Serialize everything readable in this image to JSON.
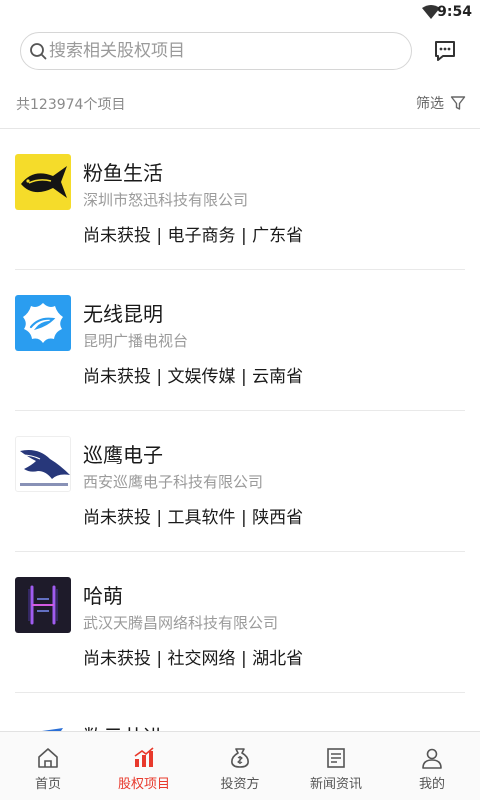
{
  "status_bar": {
    "time": "9:54"
  },
  "search": {
    "placeholder": "搜索相关股权项目"
  },
  "summary": {
    "count_text": "共123974个项目",
    "filter_label": "筛选"
  },
  "projects": [
    {
      "name": "粉鱼生活",
      "company": "深圳市怒迅科技有限公司",
      "tags": "尚未获投 | 电子商务 | 广东省",
      "logo": "fish-logo-icon"
    },
    {
      "name": "无线昆明",
      "company": "昆明广播电视台",
      "tags": "尚未获投 | 文娱传媒 | 云南省",
      "logo": "flower-logo-icon"
    },
    {
      "name": "巡鹰电子",
      "company": "西安巡鹰电子科技有限公司",
      "tags": "尚未获投 | 工具软件 | 陕西省",
      "logo": "eagle-logo-icon"
    },
    {
      "name": "哈萌",
      "company": "武汉天腾昌网络科技有限公司",
      "tags": "尚未获投 | 社交网络 | 湖北省",
      "logo": "h-logo-icon"
    },
    {
      "name": "数云共进",
      "company": "",
      "tags": "",
      "logo": "blue-logo-icon"
    }
  ],
  "tabs": [
    {
      "label": "首页",
      "icon": "home-icon",
      "active": false
    },
    {
      "label": "股权项目",
      "icon": "bar-chart-icon",
      "active": true
    },
    {
      "label": "投资方",
      "icon": "money-bag-icon",
      "active": false
    },
    {
      "label": "新闻资讯",
      "icon": "news-icon",
      "active": false
    },
    {
      "label": "我的",
      "icon": "person-icon",
      "active": false
    }
  ],
  "colors": {
    "accent": "#e8392c",
    "fish_logo_bg": "#f5dc2a",
    "flower_logo_bg": "#2a9df0",
    "h_logo_bg": "#1e1b2a",
    "eagle_logo_color": "#27377a"
  }
}
